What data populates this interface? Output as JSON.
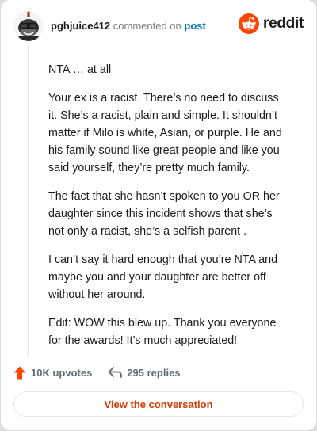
{
  "header": {
    "username": "pghjuice412",
    "action_text": "commented on",
    "post_link": "post",
    "brand": "reddit",
    "brand_color": "#ff4500"
  },
  "comment": {
    "paragraphs": [
      "NTA … at all",
      "Your ex is a racist. There’s no need to discuss it. She’s a racist, plain and simple. It shouldn’t matter if Milo is white, Asian, or purple. He and his family sound like great people and like you said yourself, they’re pretty much family.",
      "The fact that she hasn’t spoken to you OR her daughter since this incident shows that she’s not only a racist, she’s a selfish parent .",
      "I can’t say it hard enough that you’re NTA and maybe you and your daughter are better off without her around.",
      "Edit: WOW this blew up. Thank you everyone for the awards! It’s much appreciated!"
    ]
  },
  "stats": {
    "upvotes": "10K upvotes",
    "upvote_icon": "upvote-arrow-icon",
    "replies": "295 replies",
    "reply_icon": "reply-arrow-icon"
  },
  "cta": {
    "label": "View the conversation",
    "color": "#d93a00"
  }
}
